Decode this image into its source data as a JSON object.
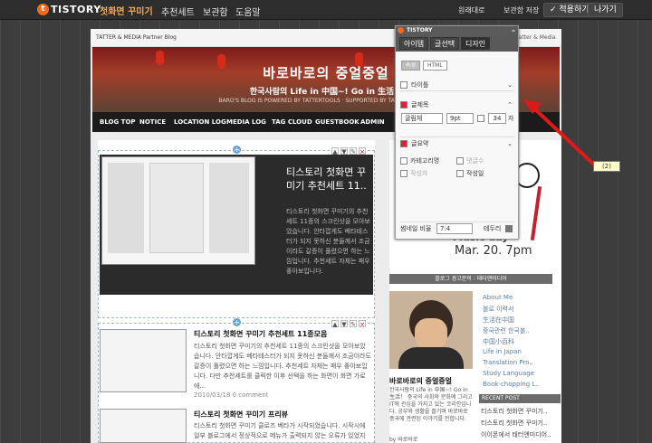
{
  "topbar": {
    "logo": "TISTORY",
    "brand_sub": "첫화면 꾸미기",
    "menu": [
      "추천세트",
      "보관함",
      "도움말"
    ],
    "link_default": "원래대로",
    "save_box": "보관함 저장",
    "apply": "✓ 적용하기",
    "exit": "나가기"
  },
  "header": {
    "mark": "TATTER & MEDIA Partner Blog",
    "right": "Tatter & Media"
  },
  "banner": {
    "title": "바로바로의 중얼중얼",
    "sub": "한국사람의 Life in 中国~! Go in 生活！",
    "cap": "BARO'S BLOG IS POWERED BY TATTERTOOLS · SUPPORTED BY TATTER & MEDIA"
  },
  "nav": [
    "BLOG TOP",
    "NOTICE",
    "LOCATION LOG",
    "MEDIA LOG",
    "TAG CLOUD",
    "GUESTBOOK",
    "ADMIN"
  ],
  "feature": {
    "title": "티스토리 첫화면 꾸미기 추천세트 11..",
    "body": "티스토리 첫화면 꾸미기의 추천세트 11종의 스크린샷을 모아보았습니다. 안타깝게도 베타테스터가 되지 못하신 분들께서 조금이라도 갈증이 풀렸으면 하는 느낌입니다. 추천세트 자체는 패우 좋아보입니다."
  },
  "post1": {
    "title": "티스토리 첫화면 꾸미기 추천세트 11종모음",
    "body": "티스토리 첫화면 꾸미기의 추천세트 11종의 스크린샷을 모아보았습니다. 안타깝게도 베타테스터가 되지 못하신 분들께서 조금이라도 갈증이 풀렸으면 하는 느낌입니다. 추천세트 자체는 패우 좋아보입니다. 다만 추천세트를 클릭한 이후 선택을 하는 화면이 화면 가로에...",
    "meta": "2010/03/18   0 comment"
  },
  "post2": {
    "title": "티스토리 첫화면 꾸미기 프리뷰",
    "body": "티스토리 첫화면 꾸미기 클로즈 베타가 시작되었습니다. 시작시에 일부 블로그에서 정상적으로 메뉴가 출력되지 않는 오류가 있었지만..."
  },
  "panel": {
    "brand": "TISTORY",
    "tabs": [
      "아이템",
      "글선택",
      "디자인"
    ],
    "subtabs": [
      "속성",
      "HTML"
    ],
    "title_label": "타이틀",
    "excerpt_label": "글제목",
    "font": "굴림체",
    "size": "9pt",
    "length": "34",
    "length_unit": "자",
    "summary_label": "글요약",
    "cat_label": "카테고리명",
    "reply_label": "댓글수",
    "author_label": "작성자",
    "date_label": "작성일",
    "ratio_label": "썸네일 비율",
    "ratio": "7:4",
    "border_label": "테두리"
  },
  "sidebar": {
    "banner_text": "Music day",
    "date": "Mar. 20. 7pm",
    "bar": "블로그 광고문의 : 태터앤미디어",
    "profile_name": "바로바로의 중얼중얼",
    "profile_text": "한국사람의 Life in 中国~! Go in 生活！ 중국의 사회와 문화에 그리고 IT에 관심을 가지고 있는 코리안입니다. 공부와 생활을 즐기며 바로바로 중국에 관련된 이야기를 전합니다.",
    "profile_by": "by 바로바로",
    "menu": [
      "About Me",
      "블로 이력서",
      "生活在中国",
      "중국관련 한국블..",
      "中国小百科",
      "Life in Japan",
      "Translation Pro..",
      "Study Language",
      "Book-chopping L.."
    ],
    "recent_header": "RECENT POST",
    "recent": [
      "티스토리 첫화면 꾸미기..",
      "티스토리 첫화면 꾸미기..",
      "이이폰에서 태터앤미디어.."
    ]
  },
  "callout": "(2)"
}
